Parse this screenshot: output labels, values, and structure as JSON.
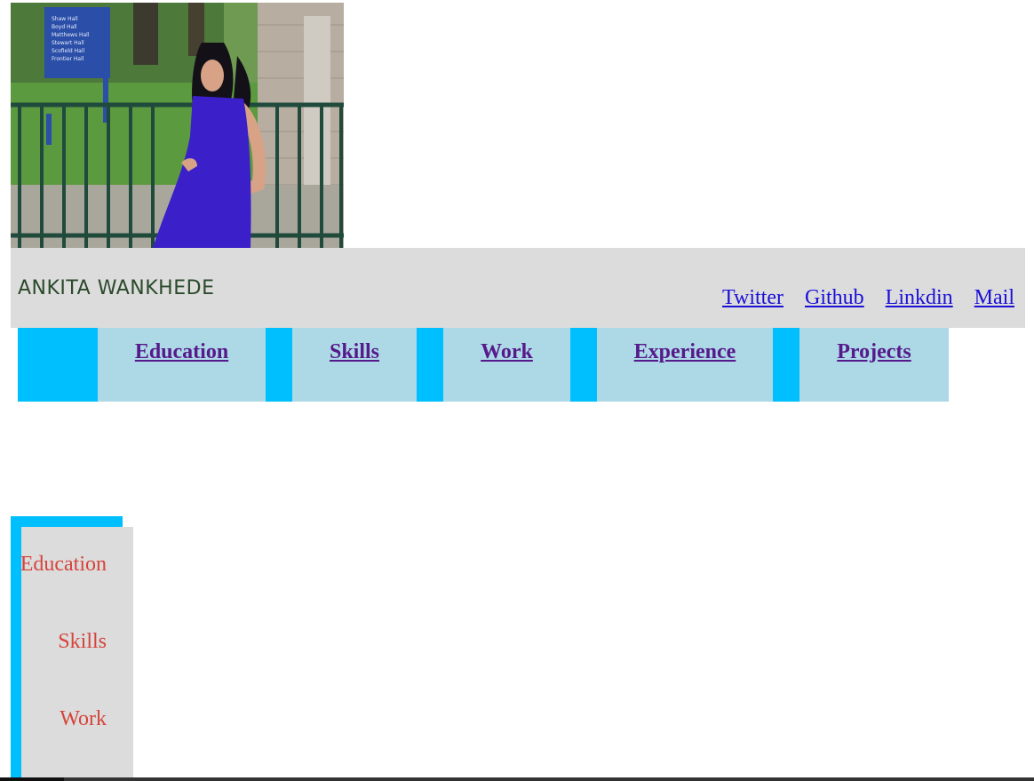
{
  "profile": {
    "photo_alt": "profile photo",
    "sign_lines": [
      "Shaw Hall",
      "Boyd Hall",
      "Matthews Hall",
      "Stewart Hall",
      "Scofield Hall",
      "Frontier Hall"
    ]
  },
  "header": {
    "name": "ANKITA WANKHEDE",
    "social_links": [
      "Twitter",
      "Github",
      "Linkdin",
      "Mail"
    ]
  },
  "nav": {
    "items": [
      "Education",
      "Skills",
      "Work",
      "Experience",
      "Projects"
    ]
  },
  "side_nav": {
    "items": [
      "Education",
      "Skills",
      "Work"
    ]
  },
  "colors": {
    "accent": "#00bfff",
    "nav_item_bg": "#add8e6",
    "header_bg": "#dcdcdc",
    "link_blue": "#1a10d6",
    "visited_purple": "#551a8b",
    "side_text": "#d5443b"
  }
}
